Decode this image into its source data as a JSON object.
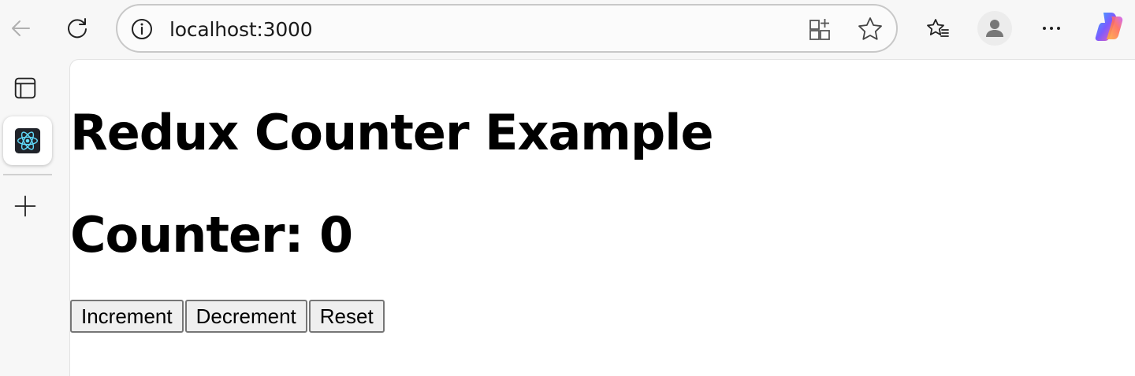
{
  "browser": {
    "url": "localhost:3000",
    "icons": {
      "back": "back-arrow-icon",
      "reload": "reload-icon",
      "site_info": "info-icon",
      "apps": "apps-add-icon",
      "favorite": "star-icon",
      "favorites_list": "favorites-list-icon",
      "profile": "profile-icon",
      "more": "more-icon",
      "copilot": "copilot-icon"
    }
  },
  "sidebar": {
    "icons": [
      "tab-actions-icon",
      "react-tab-icon",
      "new-tab-plus-icon"
    ]
  },
  "page": {
    "heading": "Redux Counter Example",
    "counter_label": "Counter: 0",
    "buttons": {
      "increment": "Increment",
      "decrement": "Decrement",
      "reset": "Reset"
    }
  }
}
